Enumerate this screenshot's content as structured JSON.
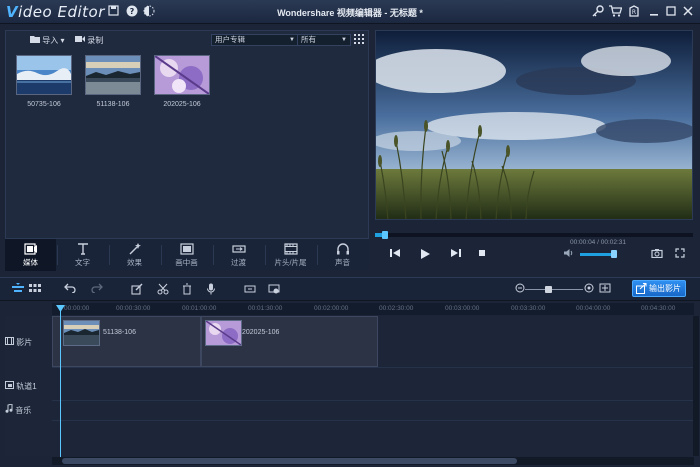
{
  "titlebar": {
    "app_name_first": "V",
    "app_name_rest": "ideo Editor",
    "title": "Wondershare 视频编辑器 - 无标题 *"
  },
  "media": {
    "import_label": "导入",
    "record_label": "录制",
    "album_select": "用户专辑",
    "filter_select": "所有",
    "items": [
      {
        "label": "50735-106"
      },
      {
        "label": "51138-106"
      },
      {
        "label": "202025-106"
      }
    ]
  },
  "tabs": [
    {
      "label": "媒体",
      "icon": "media-icon"
    },
    {
      "label": "文字",
      "icon": "text-icon"
    },
    {
      "label": "效果",
      "icon": "effect-icon"
    },
    {
      "label": "画中画",
      "icon": "pip-icon"
    },
    {
      "label": "过渡",
      "icon": "transition-icon"
    },
    {
      "label": "片头/片尾",
      "icon": "intro-credit-icon"
    },
    {
      "label": "声音",
      "icon": "sound-icon"
    }
  ],
  "preview": {
    "timecode": "00:00:04 / 00:02:31",
    "progress": 0.03,
    "volume": 0.82
  },
  "timeline": {
    "export_label": "输出影片",
    "ruler": [
      "00:00:00",
      "00:00:30:00",
      "00:01:00:00",
      "00:01:30:00",
      "00:02:00:00",
      "00:02:30:00",
      "00:03:00:00",
      "00:03:30:00",
      "00:04:00:00",
      "00:04:30:00"
    ],
    "tracks": [
      {
        "label": "影片",
        "icon": "film-icon"
      },
      {
        "label": "轨道1",
        "icon": "overlay-icon"
      },
      {
        "label": "音乐",
        "icon": "music-icon"
      }
    ],
    "clips": [
      {
        "name": "51138-106"
      },
      {
        "name": "202025-106"
      }
    ]
  },
  "colors": {
    "accent": "#1fa0e0",
    "background": "#1b2537"
  }
}
